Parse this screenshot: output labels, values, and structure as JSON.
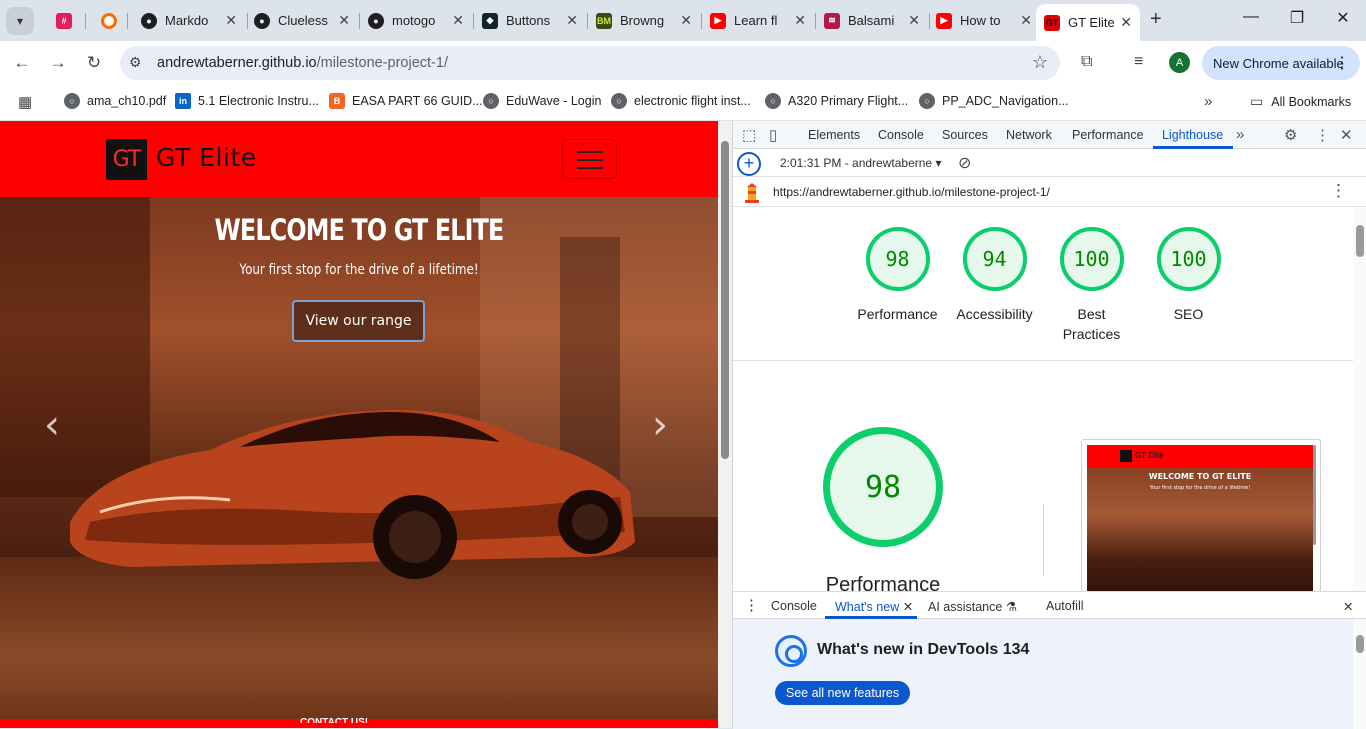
{
  "tabs": [
    {
      "title": "",
      "icon": "slack-icon",
      "color": "#e01e5a"
    },
    {
      "title": "",
      "icon": "circle-icon",
      "color": "#ff6a00"
    },
    {
      "title": "Markdo",
      "icon": "github-icon",
      "color": "#1f1f1f"
    },
    {
      "title": "Clueless",
      "icon": "github-icon",
      "color": "#1f1f1f"
    },
    {
      "title": "motogo",
      "icon": "github-icon",
      "color": "#1f1f1f"
    },
    {
      "title": "Buttons",
      "icon": "bootstrap-icon",
      "color": "#12232e"
    },
    {
      "title": "Browng",
      "icon": "bm-icon",
      "color": "#3b4a12"
    },
    {
      "title": "Learn fl",
      "icon": "youtube-icon",
      "color": "#ff0000"
    },
    {
      "title": "Balsami",
      "icon": "balsamiq-icon",
      "color": "#b0174c"
    },
    {
      "title": "How to",
      "icon": "youtube-icon",
      "color": "#ff0000"
    },
    {
      "title": "GT Elite",
      "icon": "gt-icon",
      "color": "#e00000"
    }
  ],
  "toolbar": {
    "url_host": "andrewtaberner.github.io",
    "url_path": "/milestone-project-1/",
    "avatar_letter": "A",
    "new_chrome": "New Chrome available"
  },
  "bookmarks": [
    {
      "label": "ama_ch10.pdf",
      "color": "#5f6368"
    },
    {
      "label": "5.1 Electronic Instru...",
      "color": "#0a66c2"
    },
    {
      "label": "EASA PART 66 GUID...",
      "color": "#f26522"
    },
    {
      "label": "EduWave - Login",
      "color": "#5f6368"
    },
    {
      "label": "electronic flight inst...",
      "color": "#5f6368"
    },
    {
      "label": "A320 Primary Flight...",
      "color": "#5f6368"
    },
    {
      "label": "PP_ADC_Navigation...",
      "color": "#5f6368"
    }
  ],
  "all_bookmarks": "All Bookmarks",
  "site": {
    "logo_mark": "GT",
    "logo_text": "GT Elite",
    "hero_title": "WELCOME TO GT ELITE",
    "hero_subtitle": "Your first stop for the drive of a lifetime!",
    "hero_button": "View our range",
    "footer_peek": "CONTACT US!"
  },
  "devtools": {
    "tabs": [
      "Elements",
      "Console",
      "Sources",
      "Network",
      "Performance",
      "Lighthouse"
    ],
    "active_tab": "Lighthouse",
    "run_label": "2:01:31 PM - andrewtaberne",
    "report_url": "https://andrewtaberner.github.io/milestone-project-1/",
    "scores": [
      {
        "label": "Performance",
        "value": "98"
      },
      {
        "label": "Accessibility",
        "value": "94"
      },
      {
        "label": "Best Practices",
        "value": "100"
      },
      {
        "label": "SEO",
        "value": "100"
      }
    ],
    "big_score": "98",
    "big_label": "Performance",
    "thumb_logo": "GT Elite",
    "thumb_title": "WELCOME TO GT ELITE",
    "thumb_sub": "Your first stop for the drive of a lifetime!",
    "drawer_tabs": [
      "Console",
      "What's new",
      "AI assistance",
      "Autofill"
    ],
    "whats_new_title": "What's new in DevTools 134",
    "whats_new_button": "See all new features"
  },
  "colors": {
    "brand_red": "#ff0000",
    "devtools_blue": "#0b57d0",
    "score_green": "#0cce6b"
  }
}
